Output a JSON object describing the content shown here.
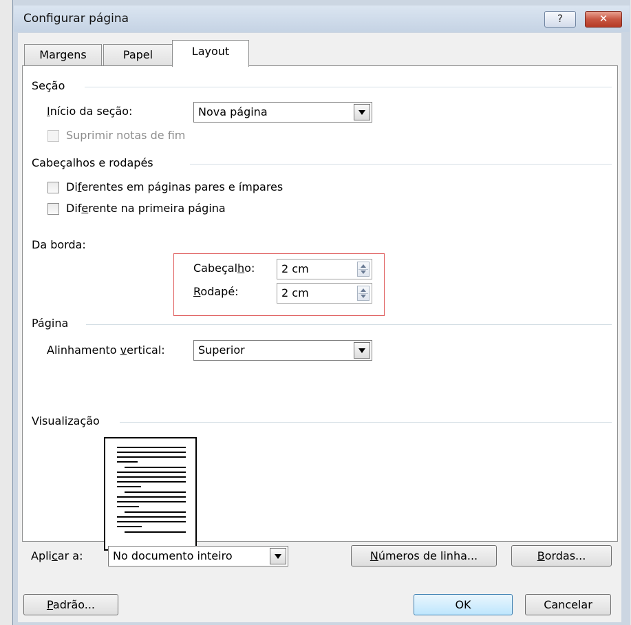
{
  "window": {
    "title": "Configurar página",
    "help_glyph": "?",
    "close_glyph": "✕"
  },
  "tabs": [
    {
      "label": "Margens",
      "active": false
    },
    {
      "label": "Papel",
      "active": false
    },
    {
      "label": "Layout",
      "active": true
    }
  ],
  "section": {
    "heading": "Seção",
    "start_label_pre": "",
    "start_label_ul": "I",
    "start_label_post": "nício da seção:",
    "start_value": "Nova página",
    "suppress_endnotes_label": "Suprimir notas de fim",
    "suppress_endnotes_checked": false,
    "suppress_endnotes_enabled": false
  },
  "headers_footers": {
    "heading": "Cabeçalhos e rodapés",
    "odd_even_pre": "Di",
    "odd_even_ul": "f",
    "odd_even_post": "erentes em páginas pares e ímpares",
    "odd_even_checked": false,
    "first_page_pre": "Dif",
    "first_page_ul": "e",
    "first_page_post": "rente na primeira página",
    "first_page_checked": false,
    "from_edge_label": "Da borda:",
    "header_pre": "Cabeçal",
    "header_ul": "h",
    "header_post": "o:",
    "header_value": "2 cm",
    "footer_pre": "",
    "footer_ul": "R",
    "footer_post": "odapé:",
    "footer_value": "2 cm"
  },
  "page": {
    "heading": "Página",
    "valign_pre": "Alinhamento ",
    "valign_ul": "v",
    "valign_post": "ertical:",
    "valign_value": "Superior"
  },
  "preview": {
    "heading": "Visualização"
  },
  "apply": {
    "label_pre": "Apli",
    "label_ul": "c",
    "label_post": "ar a:",
    "value": "No documento inteiro"
  },
  "buttons": {
    "line_numbers_pre": "",
    "line_numbers_ul": "N",
    "line_numbers_post": "úmeros de linha...",
    "borders_pre": "",
    "borders_ul": "B",
    "borders_post": "ordas...",
    "default_pre": "",
    "default_ul": "P",
    "default_post": "adrão...",
    "ok": "OK",
    "cancel": "Cancelar"
  }
}
